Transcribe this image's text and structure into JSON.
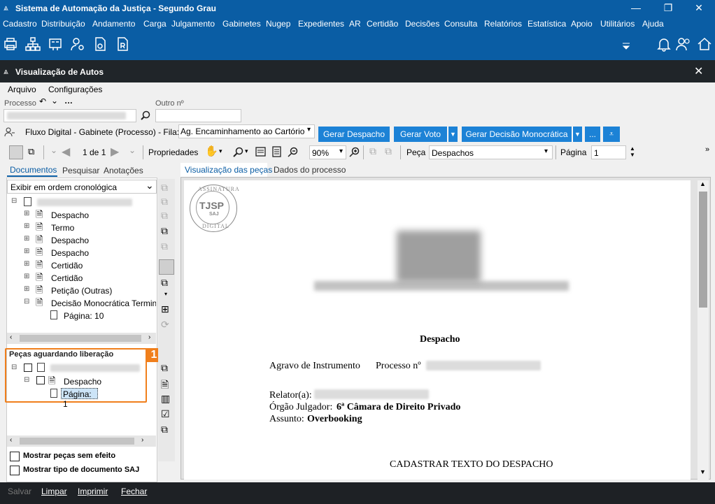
{
  "app": {
    "title": "Sistema de Automação da Justiça - Segundo Grau"
  },
  "menu": [
    "Cadastro",
    "Distribuição",
    "Andamento",
    "Carga",
    "Julgamento",
    "Gabinetes",
    "Nugep",
    "Expedientes",
    "AR",
    "Certidão",
    "Decisões",
    "Consulta",
    "Relatórios",
    "Estatística",
    "Apoio",
    "Utilitários",
    "Ajuda"
  ],
  "window": {
    "title": "Visualização de Autos"
  },
  "submenu": {
    "file": "Arquivo",
    "settings": "Configurações"
  },
  "process": {
    "label": "Processo",
    "other_label": "Outro nº"
  },
  "flow": {
    "label": "Fluxo Digital - Gabinete (Processo) - Fila:",
    "queue": "Ag. Encaminhamento ao Cartório",
    "btn_despacho": "Gerar Despacho",
    "btn_voto": "Gerar Voto",
    "btn_decisao": "Gerar Decisão Monocrática",
    "btn_more": "..."
  },
  "viewer": {
    "page_of": "1 de 1",
    "properties": "Propriedades",
    "zoom": "90%",
    "peca_label": "Peça",
    "peca_value": "Despachos",
    "pagina_label": "Página",
    "pagina_value": "1"
  },
  "left_tabs": {
    "docs": "Documentos",
    "search": "Pesquisar",
    "notes": "Anotações"
  },
  "order": "Exibir em ordem cronológica",
  "tree": [
    "Despacho",
    "Termo",
    "Despacho",
    "Despacho",
    "Certidão",
    "Certidão",
    "Petição (Outras)",
    "Decisão Monocrática Terminat"
  ],
  "tree_page": "Página: 10",
  "pending": {
    "title": "Peças aguardando liberação",
    "badge": "1",
    "item": "Despacho",
    "page": "Página: 1"
  },
  "checks": {
    "no_effect": "Mostrar peças sem efeito",
    "doc_type": "Mostrar tipo de documento SAJ"
  },
  "right_tabs": {
    "view": "Visualização das peças",
    "data": "Dados do processo"
  },
  "seal": {
    "top": "ASSINATURA",
    "mid": "TJSP",
    "saj": "SAJ",
    "bottom": "DIGITAL"
  },
  "doc": {
    "title": "Despacho",
    "agravo": "Agravo de Instrumento",
    "processo": "Processo nº",
    "relator": "Relator(a):",
    "orgao_label": "Órgão Julgador:",
    "orgao": "6ª Câmara de Direito Privado",
    "assunto_label": "Assunto:",
    "assunto": "Overbooking",
    "body": "CADASTRAR TEXTO DO DESPACHO"
  },
  "status": {
    "save": "Salvar",
    "clear": "Limpar",
    "print": "Imprimir",
    "close": "Fechar"
  }
}
